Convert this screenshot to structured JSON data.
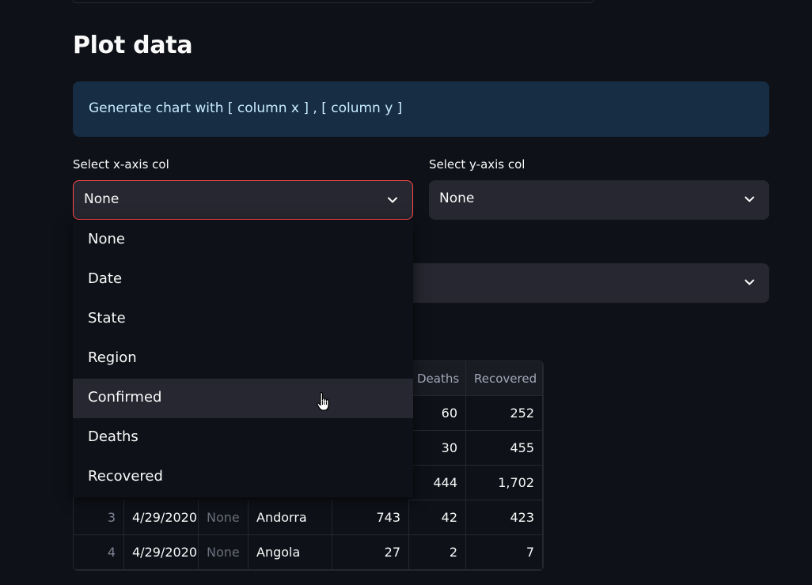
{
  "section": {
    "title": "Plot data"
  },
  "info": {
    "text": "Generate chart with [ column x ] , [ column y ]"
  },
  "x_select": {
    "label": "Select x-axis col",
    "value": "None"
  },
  "y_select": {
    "label": "Select y-axis col",
    "value": "None"
  },
  "dropdown": {
    "options": [
      "None",
      "Date",
      "State",
      "Region",
      "Confirmed",
      "Deaths",
      "Recovered"
    ],
    "hovered": "Confirmed"
  },
  "table": {
    "headers": {
      "deaths": "Deaths",
      "recovered": "Recovered"
    },
    "partial_rows": [
      {
        "deaths": "60",
        "recovered": "252"
      },
      {
        "deaths": "30",
        "recovered": "455"
      },
      {
        "deaths": "444",
        "recovered": "1,702"
      }
    ],
    "rows": [
      {
        "index": "3",
        "date": "4/29/2020",
        "state": "None",
        "region": "Andorra",
        "confirmed": "743",
        "deaths": "42",
        "recovered": "423"
      },
      {
        "index": "4",
        "date": "4/29/2020",
        "state": "None",
        "region": "Angola",
        "confirmed": "27",
        "deaths": "2",
        "recovered": "7"
      }
    ]
  },
  "colors": {
    "background": "#0e1117",
    "widget": "#262730",
    "focus_border": "#ff4b4b",
    "info_bg": "#172d43",
    "info_text": "#c7ebff"
  }
}
